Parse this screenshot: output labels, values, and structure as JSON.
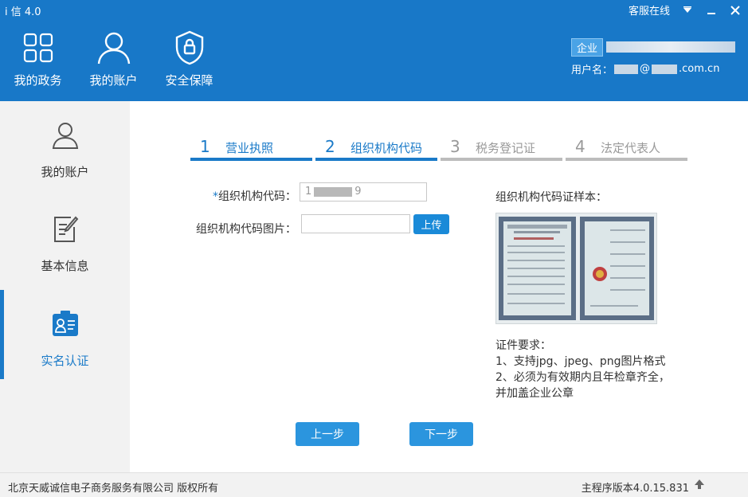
{
  "app": {
    "title": "i 信 4.0",
    "service_status": "客服在线"
  },
  "nav": [
    {
      "label": "我的政务",
      "icon": "grid-icon"
    },
    {
      "label": "我的账户",
      "icon": "user-icon"
    },
    {
      "label": "安全保障",
      "icon": "shield-icon"
    }
  ],
  "user": {
    "badge": "企业",
    "username_label": "用户名：",
    "username_at": "@",
    "username_domain": ".com.cn"
  },
  "sidebar": [
    {
      "label": "我的账户",
      "icon": "user-outline-icon"
    },
    {
      "label": "基本信息",
      "icon": "document-edit-icon"
    },
    {
      "label": "实名认证",
      "icon": "id-card-icon"
    }
  ],
  "steps": [
    {
      "num": "1",
      "label": "营业执照",
      "state": "done"
    },
    {
      "num": "2",
      "label": "组织机构代码",
      "state": "done"
    },
    {
      "num": "3",
      "label": "税务登记证",
      "state": "todo"
    },
    {
      "num": "4",
      "label": "法定代表人",
      "state": "todo"
    }
  ],
  "form": {
    "org_code_required": "*",
    "org_code_label": "组织机构代码：",
    "org_code_value_start": "1",
    "org_code_value_end": "9",
    "org_image_label": "组织机构代码图片：",
    "upload_label": "上传"
  },
  "sample": {
    "title": "组织机构代码证样本："
  },
  "requirements": {
    "title": "证件要求：",
    "line1": "1、支持jpg、jpeg、png图片格式",
    "line2": "2、必须为有效期内且年检章齐全，",
    "line3": "并加盖企业公章"
  },
  "buttons": {
    "prev": "上一步",
    "next": "下一步"
  },
  "footer": {
    "copyright": "北京天威诚信电子商务服务有限公司 版权所有",
    "version": "主程序版本4.0.15.831"
  },
  "colors": {
    "header": "#1878c8",
    "accent": "#1a7ac8",
    "button": "#2b95de"
  }
}
